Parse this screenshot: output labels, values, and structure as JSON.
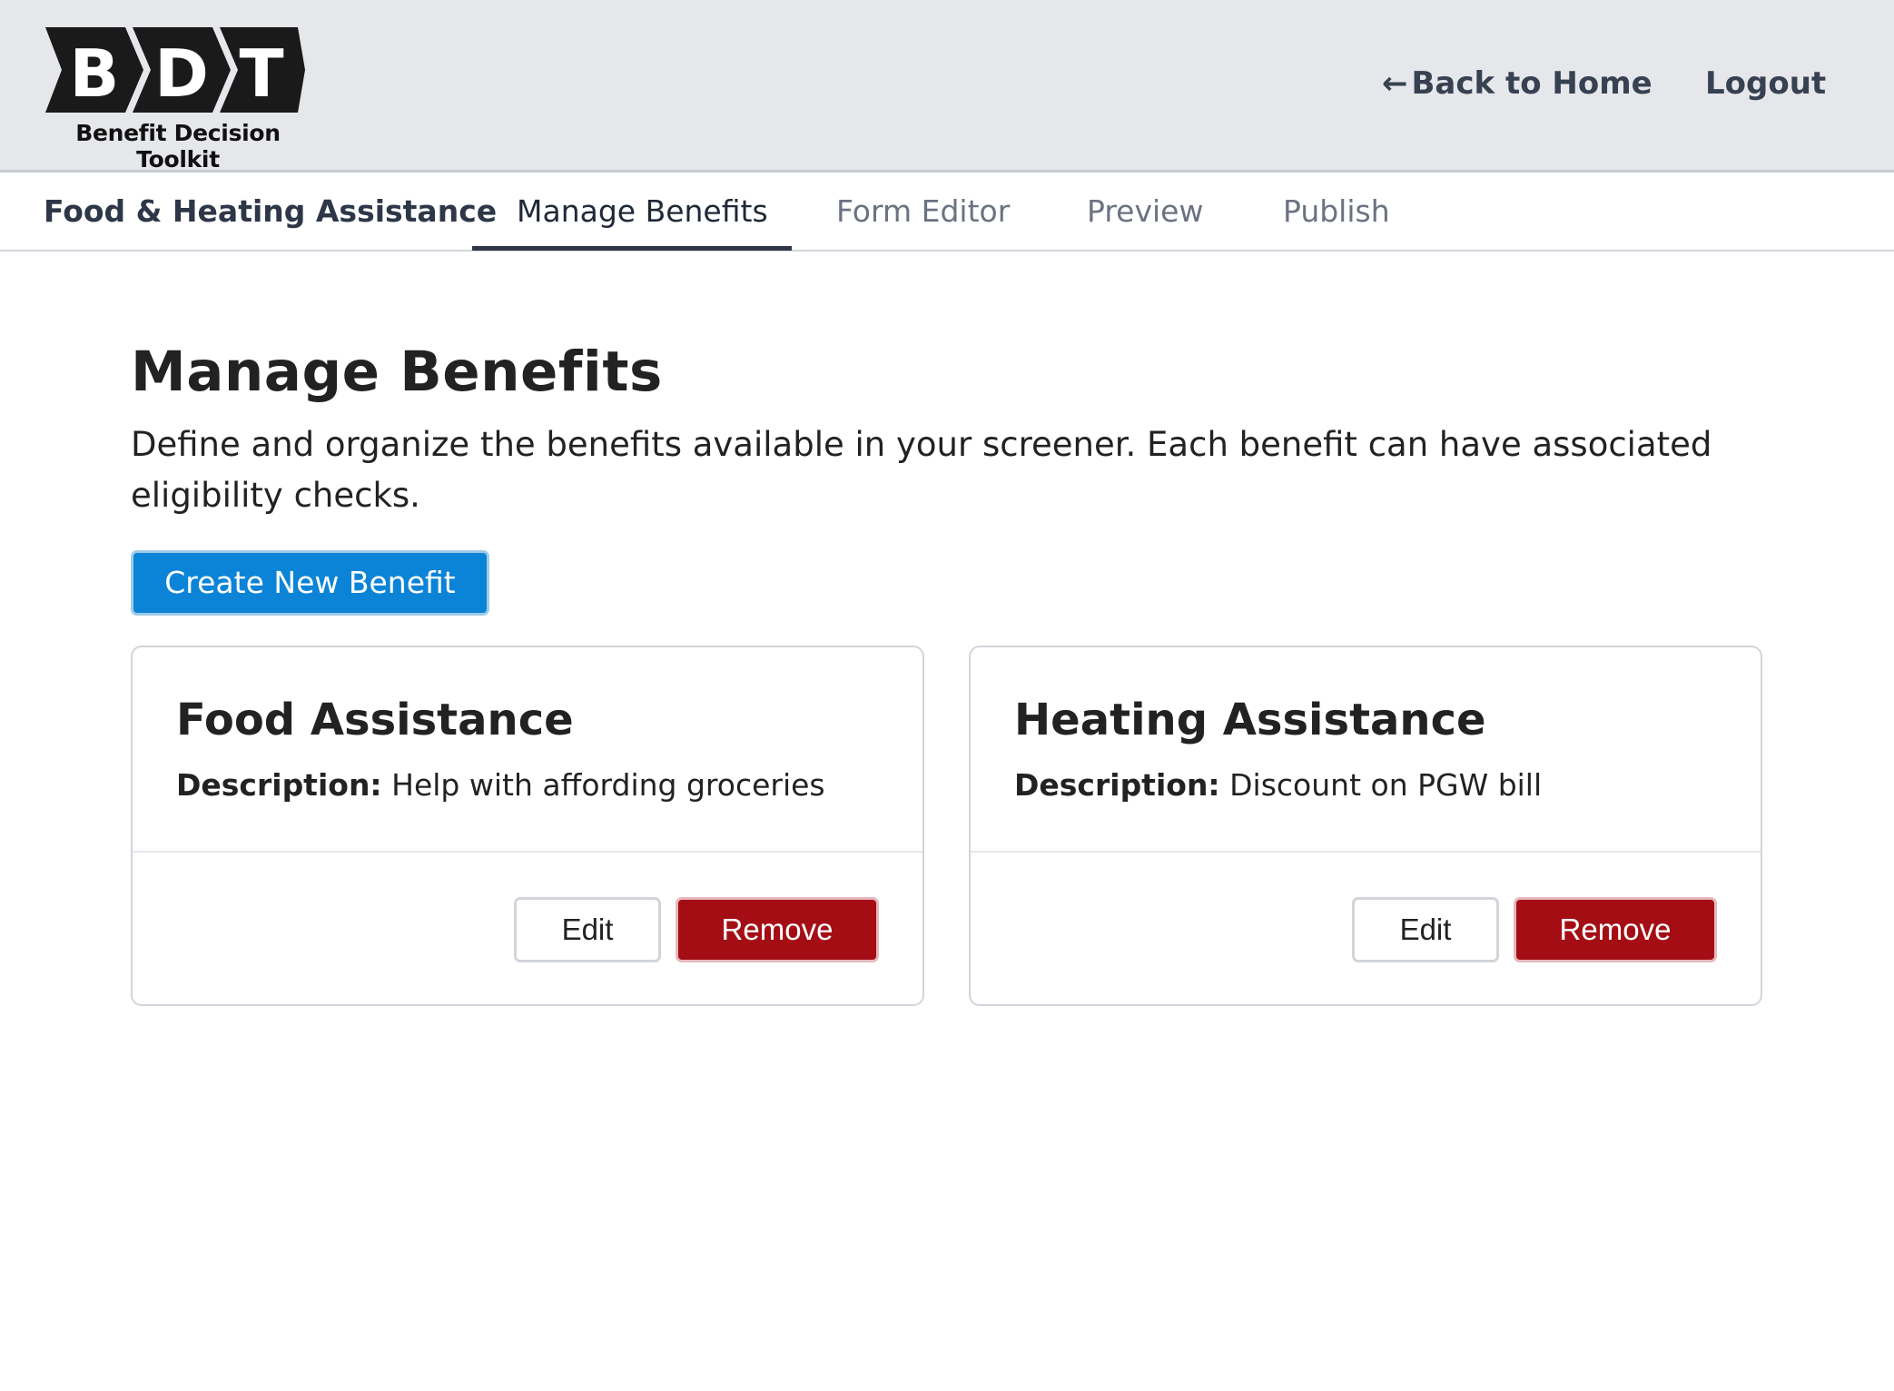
{
  "header": {
    "logo_letters": [
      "B",
      "D",
      "T"
    ],
    "logo_subtitle": "Benefit Decision Toolkit",
    "back_arrow": "←",
    "back_label": "Back to Home",
    "logout_label": "Logout"
  },
  "tabs": {
    "project_name": "Food & Heating Assistance",
    "items": [
      {
        "label": "Manage Benefits",
        "active": true
      },
      {
        "label": "Form Editor",
        "active": false
      },
      {
        "label": "Preview",
        "active": false
      },
      {
        "label": "Publish",
        "active": false
      }
    ]
  },
  "main": {
    "title": "Manage Benefits",
    "description": "Define and organize the benefits available in your screener. Each benefit can have associated eligibility checks.",
    "create_button_label": "Create New Benefit"
  },
  "benefits": [
    {
      "name": "Food Assistance",
      "description_label": "Description:",
      "description": "Help with affording groceries",
      "edit_label": "Edit",
      "remove_label": "Remove"
    },
    {
      "name": "Heating Assistance",
      "description_label": "Description:",
      "description": "Discount on PGW bill",
      "edit_label": "Edit",
      "remove_label": "Remove"
    }
  ],
  "colors": {
    "header_bg": "#e5e7eb",
    "primary": "#0b84d8",
    "danger": "#a50d15",
    "logo_dark": "#1a1a1a"
  }
}
